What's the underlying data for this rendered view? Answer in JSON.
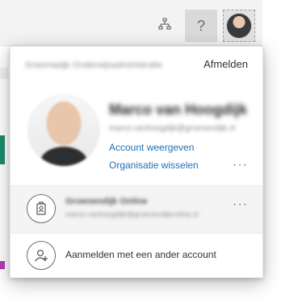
{
  "topbar": {
    "org_icon": "org-chart-icon",
    "help_label": "?",
    "avatar_icon": "user-avatar"
  },
  "account_menu": {
    "tenant_name": "Grasmaaijk Onderwijsadministratie",
    "signout_label": "Afmelden",
    "user": {
      "display_name": "Marco van Hoogdijk",
      "email": "marco.vanhoogdijk@groenendijk.nl"
    },
    "links": {
      "view_account": "Account weergeven",
      "switch_org": "Organisatie wisselen"
    },
    "more_label": "···",
    "other_tenant": {
      "name": "Groenendijk Online",
      "email": "marco.vanhoogdijk@groenendijkonline.nl",
      "icon": "badge-icon"
    },
    "other_account_label": "Aanmelden met een ander account",
    "other_account_icon": "add-person-icon"
  }
}
